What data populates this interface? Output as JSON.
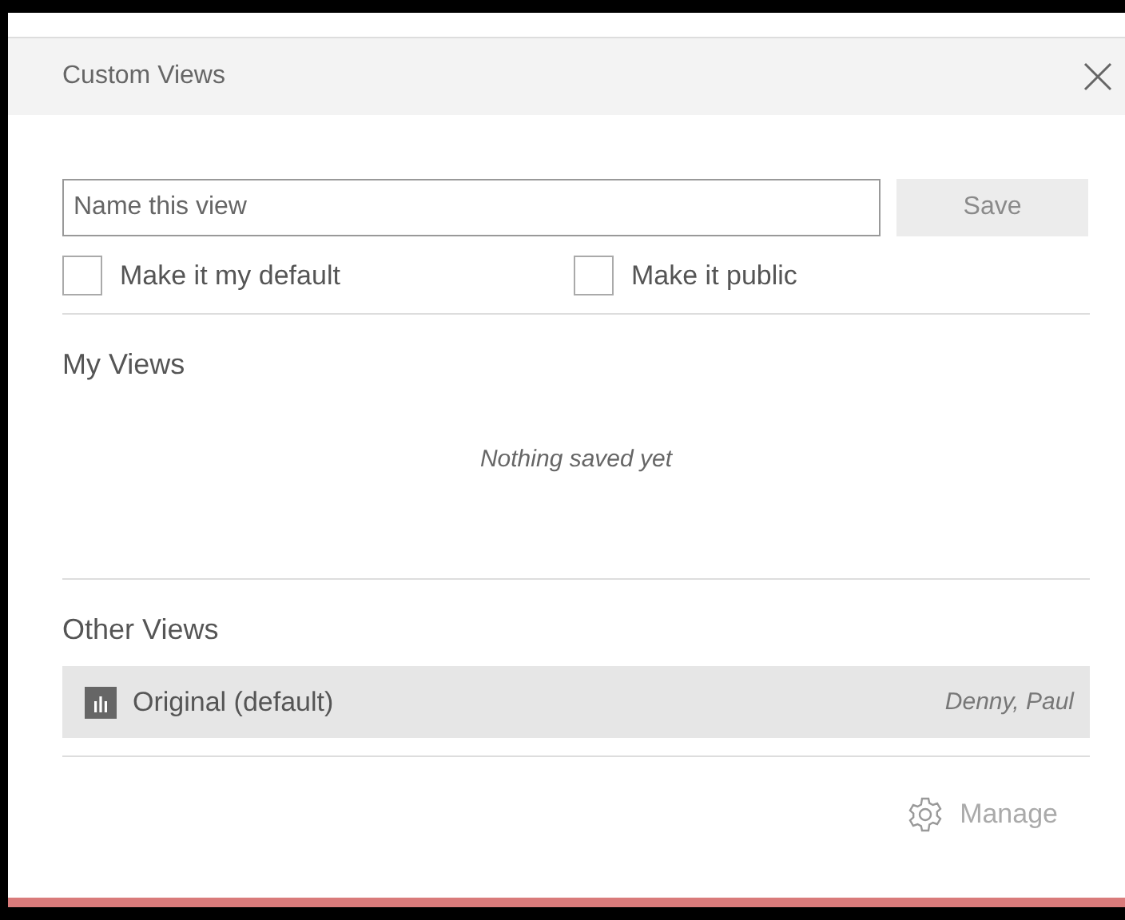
{
  "dialog": {
    "title": "Custom Views"
  },
  "name_field": {
    "placeholder": "Name this view"
  },
  "save_button": {
    "label": "Save",
    "disabled": true
  },
  "options": [
    {
      "label": "Make it my default",
      "checked": false
    },
    {
      "label": "Make it public",
      "checked": false
    }
  ],
  "my_views": {
    "heading": "My Views",
    "empty_message": "Nothing saved yet"
  },
  "other_views": {
    "heading": "Other Views",
    "items": [
      {
        "name": "Original (default)",
        "owner": "Denny, Paul",
        "selected": true
      }
    ]
  },
  "manage_button": {
    "label": "Manage"
  }
}
